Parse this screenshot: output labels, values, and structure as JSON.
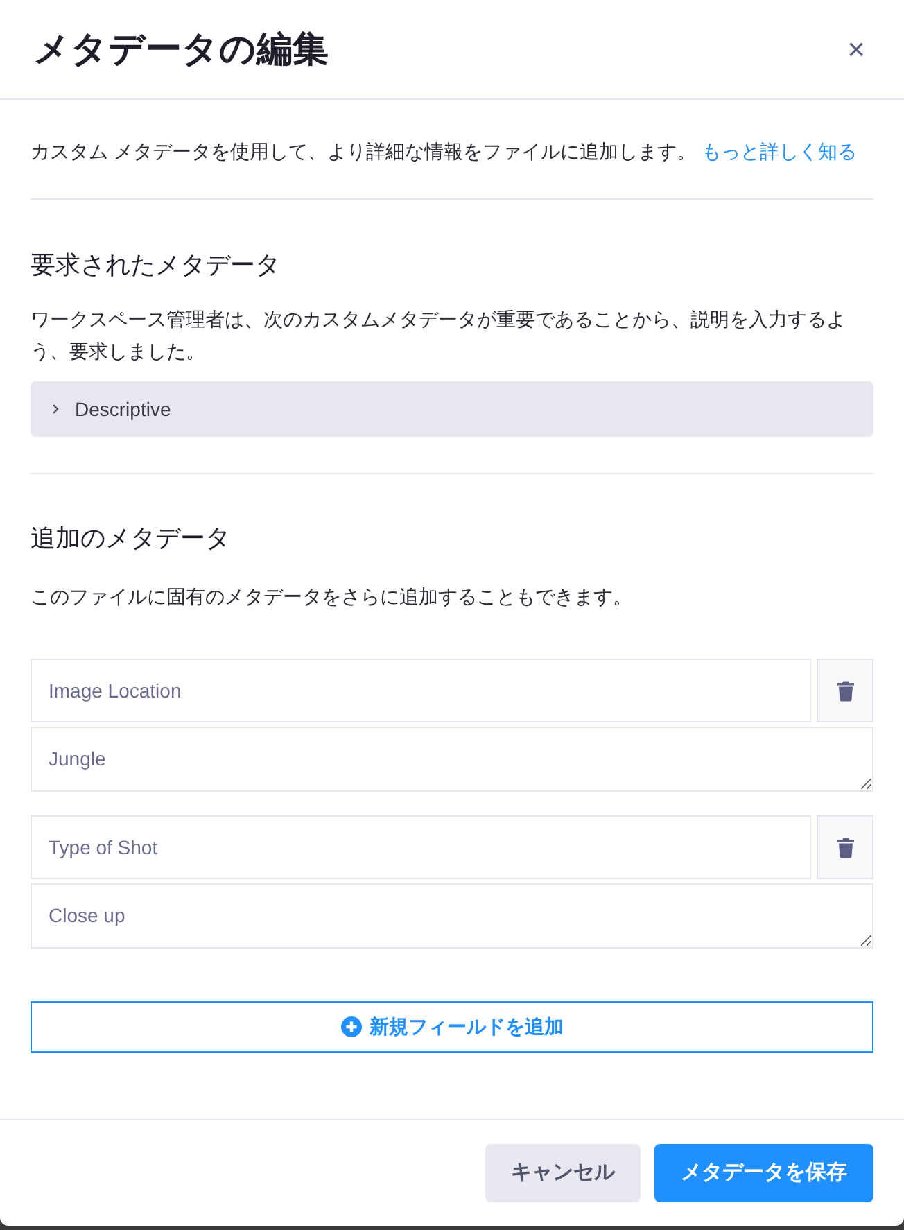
{
  "dialog": {
    "title": "メタデータの編集",
    "close": "×"
  },
  "intro": {
    "text": "カスタム メタデータを使用して、より詳細な情報をファイルに追加します。",
    "link": "もっと詳しく知る"
  },
  "required": {
    "heading": "要求されたメタデータ",
    "description": "ワークスペース管理者は、次のカスタムメタデータが重要であることから、説明を入力するよう、要求しました。",
    "groups": [
      {
        "label": "Descriptive",
        "expanded": false
      }
    ]
  },
  "additional": {
    "heading": "追加のメタデータ",
    "description": "このファイルに固有のメタデータをさらに追加することもできます。",
    "fields": [
      {
        "name": "Image Location",
        "value": "Jungle"
      },
      {
        "name": "Type of Shot",
        "value": "Close up"
      }
    ],
    "add_button": "新規フィールドを追加"
  },
  "footer": {
    "buttons": [
      {
        "label": "キャンセル",
        "kind": "secondary"
      },
      {
        "label": "メタデータを保存",
        "kind": "primary"
      }
    ]
  }
}
